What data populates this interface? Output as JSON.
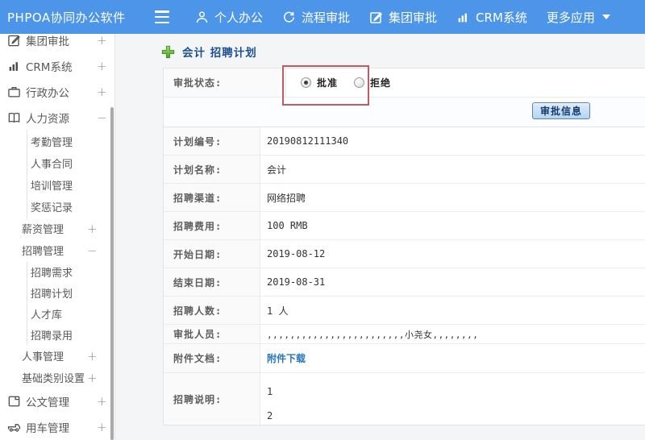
{
  "header": {
    "title": "PHPOA协同办公软件",
    "nav": [
      {
        "label": "个人办公",
        "icon": "person-icon"
      },
      {
        "label": "流程审批",
        "icon": "flow-icon"
      },
      {
        "label": "集团审批",
        "icon": "edit-square-icon"
      },
      {
        "label": "CRM系统",
        "icon": "bar-chart-icon"
      },
      {
        "label": "更多应用",
        "icon": "caret-down-icon"
      }
    ]
  },
  "sidebar": {
    "items": [
      {
        "label": "集团审批",
        "icon": "edit-square-icon",
        "expander": "+",
        "level": 1
      },
      {
        "label": "CRM系统",
        "icon": "bar-chart-icon",
        "expander": "+",
        "level": 1
      },
      {
        "label": "行政办公",
        "icon": "briefcase-icon",
        "expander": "+",
        "level": 1
      },
      {
        "label": "人力资源",
        "icon": "book-icon",
        "expander": "−",
        "level": 1
      },
      {
        "label": "考勤管理",
        "level": 2
      },
      {
        "label": "人事合同",
        "level": 2
      },
      {
        "label": "培训管理",
        "level": 2
      },
      {
        "label": "奖惩记录",
        "level": 2
      },
      {
        "label": "薪资管理",
        "expander": "+",
        "level": 2
      },
      {
        "label": "招聘管理",
        "expander": "−",
        "level": 2
      },
      {
        "label": "招聘需求",
        "level": 3
      },
      {
        "label": "招聘计划",
        "level": 3
      },
      {
        "label": "人才库",
        "level": 3
      },
      {
        "label": "招聘录用",
        "level": 3
      },
      {
        "label": "人事管理",
        "expander": "+",
        "level": 2
      },
      {
        "label": "基础类别设置",
        "expander": "+",
        "level": 2
      },
      {
        "label": "公文管理",
        "icon": "document-icon",
        "expander": "+",
        "level": 1
      },
      {
        "label": "用车管理",
        "icon": "car-icon",
        "expander": "+",
        "level": 1
      }
    ]
  },
  "main": {
    "breadcrumb": {
      "title": "会计 招聘计划",
      "icon": "green-plus-icon"
    },
    "status_row": {
      "label": "审批状态:",
      "options": [
        {
          "label": "批准",
          "selected": true
        },
        {
          "label": "拒绝",
          "selected": false
        }
      ]
    },
    "approve_button": "审批信息",
    "rows": [
      {
        "label": "计划编号:",
        "value": "20190812111340"
      },
      {
        "label": "计划名称:",
        "value": "会计"
      },
      {
        "label": "招聘渠道:",
        "value": "网络招聘"
      },
      {
        "label": "招聘费用:",
        "value": "100 RMB"
      },
      {
        "label": "开始日期:",
        "value": "2019-08-12"
      },
      {
        "label": "结束日期:",
        "value": "2019-08-31"
      },
      {
        "label": "招聘人数:",
        "value": "1 人"
      },
      {
        "label": "审批人员:",
        "value": ",,,,,,,,,,,,,,,,,,,,,,,,小尧女,,,,,,,,"
      },
      {
        "label": "附件文档:",
        "value": "附件下载",
        "link": true
      },
      {
        "label": "招聘说明:",
        "lines": [
          "1",
          "2"
        ]
      }
    ]
  },
  "colors": {
    "header_blue": "#4d95e9",
    "breadcrumb_blue": "#1d4f90",
    "link_blue": "#2a76b8",
    "annotation_red": "#c05a63",
    "button_face": "#b4d5f1",
    "plus_green": "#5aaa33"
  }
}
